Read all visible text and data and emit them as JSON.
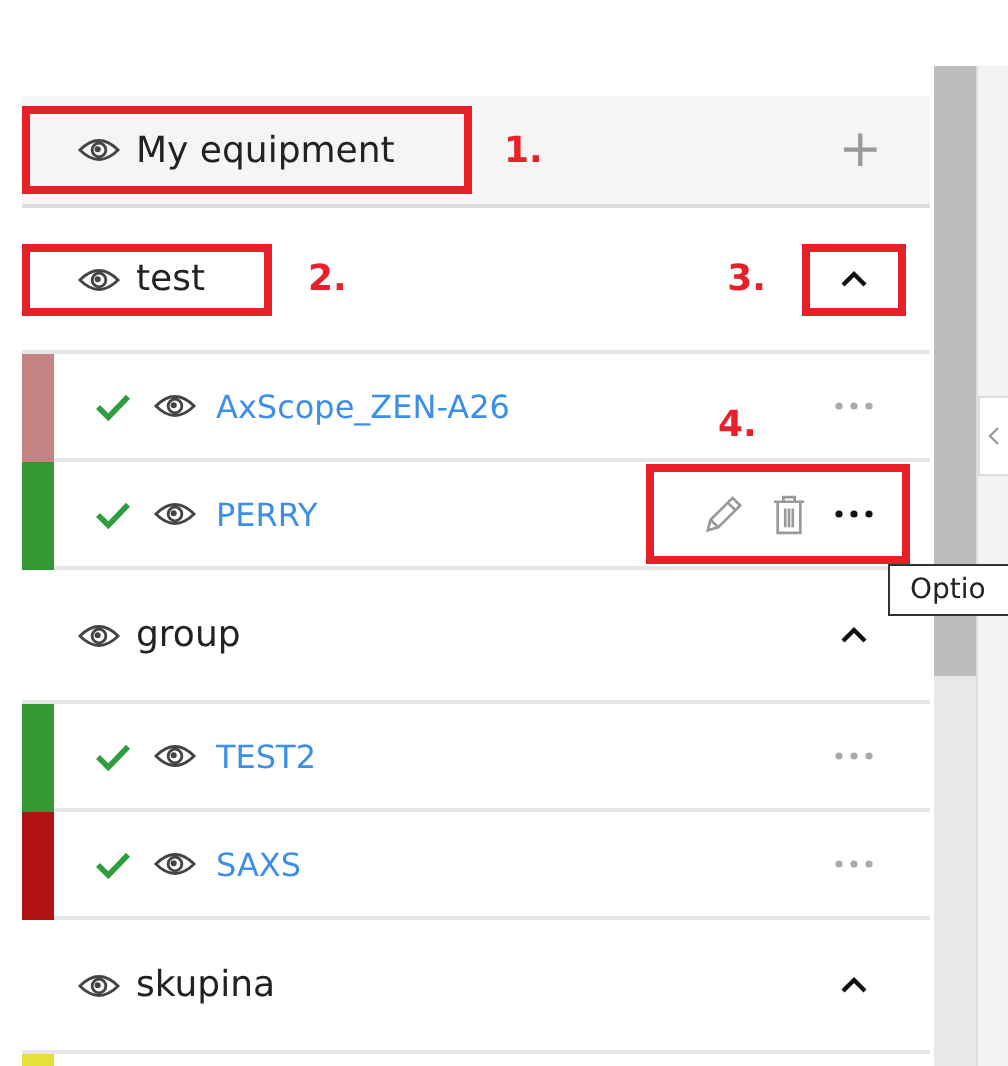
{
  "panel": {
    "title": "My equipment",
    "title_annotation": "1.",
    "add_button": "+"
  },
  "groups": [
    {
      "name": "test",
      "expanded": true,
      "name_annotation": "2.",
      "toggle_annotation": "3.",
      "items": [
        {
          "name": "AxScope_ZEN-A26",
          "color": "#c48484",
          "checked": true,
          "hovered": false
        },
        {
          "name": "PERRY",
          "color": "#339933",
          "checked": true,
          "hovered": true,
          "actions_annotation": "4."
        }
      ]
    },
    {
      "name": "group",
      "expanded": true,
      "items": [
        {
          "name": "TEST2",
          "color": "#339933",
          "checked": true,
          "hovered": false
        },
        {
          "name": "SAXS",
          "color": "#b31212",
          "checked": true,
          "hovered": false
        }
      ]
    },
    {
      "name": "skupina",
      "expanded": true,
      "items": [
        {
          "color": "#e8e03a"
        }
      ]
    }
  ],
  "tooltip": "Optio"
}
